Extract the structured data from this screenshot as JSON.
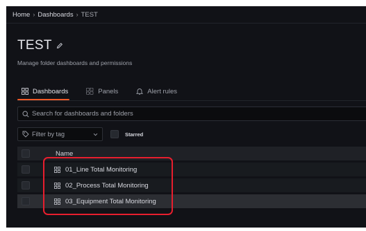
{
  "breadcrumb": {
    "home": "Home",
    "dashboards": "Dashboards",
    "current": "TEST",
    "separator": "›"
  },
  "folder": {
    "title": "TEST",
    "subtitle": "Manage folder dashboards and permissions"
  },
  "tabs": [
    {
      "label": "Dashboards",
      "icon": "apps-icon",
      "active": true
    },
    {
      "label": "Panels",
      "icon": "library-panel-icon",
      "active": false
    },
    {
      "label": "Alert rules",
      "icon": "bell-icon",
      "active": false
    }
  ],
  "search": {
    "placeholder": "Search for dashboards and folders",
    "value": ""
  },
  "filters": {
    "tag_label": "Filter by tag",
    "starred_label": "Starred"
  },
  "table": {
    "header": "Name",
    "rows": [
      {
        "name": "01_Line Total Monitoring"
      },
      {
        "name": "02_Process Total Monitoring"
      },
      {
        "name": "03_Equipment Total Monitoring"
      }
    ]
  },
  "colors": {
    "background": "#111217",
    "accent": "#f05a28",
    "highlight": "#e81e2e"
  }
}
